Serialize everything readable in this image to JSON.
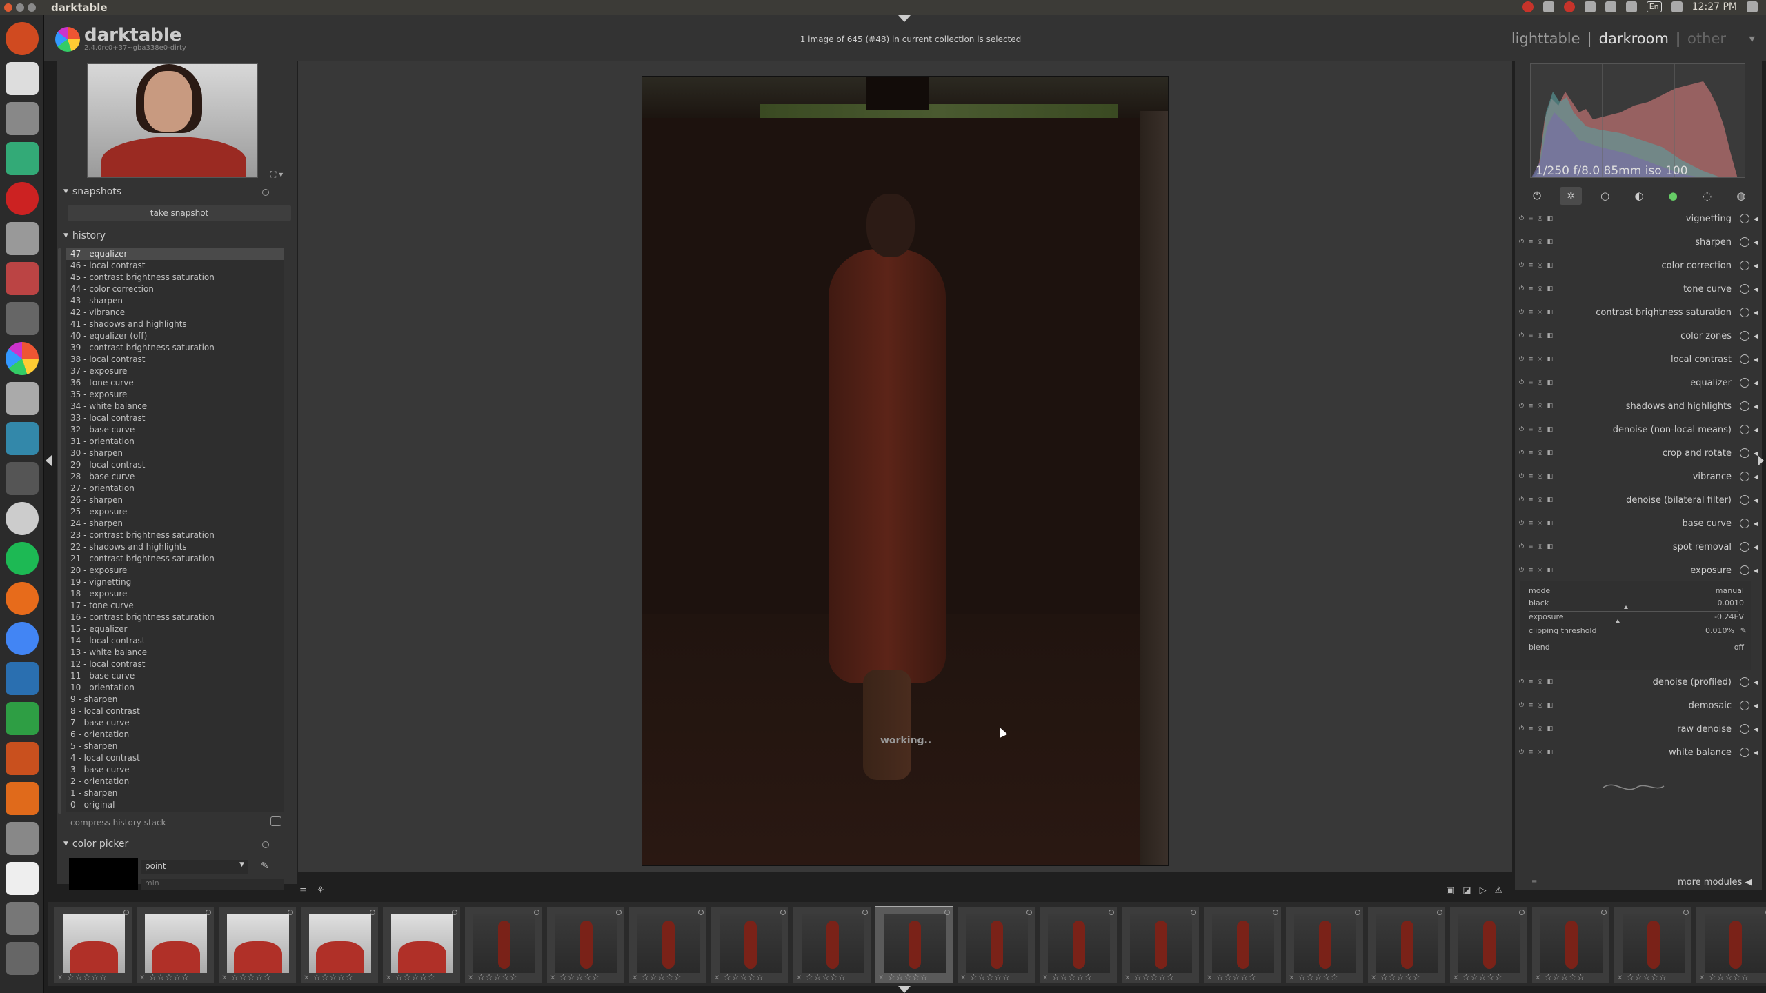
{
  "os": {
    "window_title": "darktable",
    "keyboard_layout": "En",
    "clock": "12:27 PM"
  },
  "header": {
    "app_name": "darktable",
    "version": "2.4.0rc0+37~gba338e0-dirty",
    "status": "1 image of 645 (#48) in current collection is selected",
    "views": {
      "lighttable": "lighttable",
      "darkroom": "darkroom",
      "other": "other",
      "sep": "|"
    }
  },
  "left_panel": {
    "snapshots": {
      "title": "snapshots",
      "take_snapshot": "take snapshot"
    },
    "history": {
      "title": "history",
      "items": [
        "47 - equalizer",
        "46 - local contrast",
        "45 - contrast brightness saturation",
        "44 - color correction",
        "43 - sharpen",
        "42 - vibrance",
        "41 - shadows and highlights",
        "40 - equalizer (off)",
        "39 - contrast brightness saturation",
        "38 - local contrast",
        "37 - exposure",
        "36 - tone curve",
        "35 - exposure",
        "34 - white balance",
        "33 - local contrast",
        "32 - base curve",
        "31 - orientation",
        "30 - sharpen",
        "29 - local contrast",
        "28 - base curve",
        "27 - orientation",
        "26 - sharpen",
        "25 - exposure",
        "24 - sharpen",
        "23 - contrast brightness saturation",
        "22 - shadows and highlights",
        "21 - contrast brightness saturation",
        "20 - exposure",
        "19 - vignetting",
        "18 - exposure",
        "17 - tone curve",
        "16 - contrast brightness saturation",
        "15 - equalizer",
        "14 - local contrast",
        "13 - white balance",
        "12 - local contrast",
        "11 - base curve",
        "10 - orientation",
        "9 - sharpen",
        "8 - local contrast",
        "7 - base curve",
        "6 - orientation",
        "5 - sharpen",
        "4 - local contrast",
        "3 - base curve",
        "2 - orientation",
        "1 - sharpen",
        "0 - original"
      ],
      "compress": "compress history stack"
    },
    "color_picker": {
      "title": "color picker",
      "mode": "point",
      "sub": "min"
    }
  },
  "center": {
    "working": "working.."
  },
  "right_panel": {
    "histogram_info": "1/250 f/8.0 85mm iso 100",
    "modules": [
      "vignetting",
      "sharpen",
      "color correction",
      "tone curve",
      "contrast brightness saturation",
      "color zones",
      "local contrast",
      "equalizer",
      "shadows and highlights",
      "denoise (non-local means)",
      "crop and rotate",
      "vibrance",
      "denoise (bilateral filter)",
      "base curve",
      "spot removal",
      "exposure"
    ],
    "exposure": {
      "mode_label": "mode",
      "mode_value": "manual",
      "black_label": "black",
      "black_value": "0.0010",
      "exposure_label": "exposure",
      "exposure_value": "-0.24EV",
      "clip_label": "clipping threshold",
      "clip_value": "0.010%",
      "blend_label": "blend",
      "blend_value": "off"
    },
    "modules_after": [
      "denoise (profiled)",
      "demosaic",
      "raw denoise",
      "white balance"
    ],
    "more_modules": "more modules"
  },
  "filmstrip": {
    "thumbs": [
      "light",
      "light",
      "light",
      "light",
      "light",
      "dark",
      "dark",
      "dark",
      "dark",
      "dark",
      "cur",
      "dark",
      "dark",
      "dark",
      "dark",
      "dark",
      "dark",
      "dark",
      "dark",
      "dark",
      "dark"
    ]
  }
}
